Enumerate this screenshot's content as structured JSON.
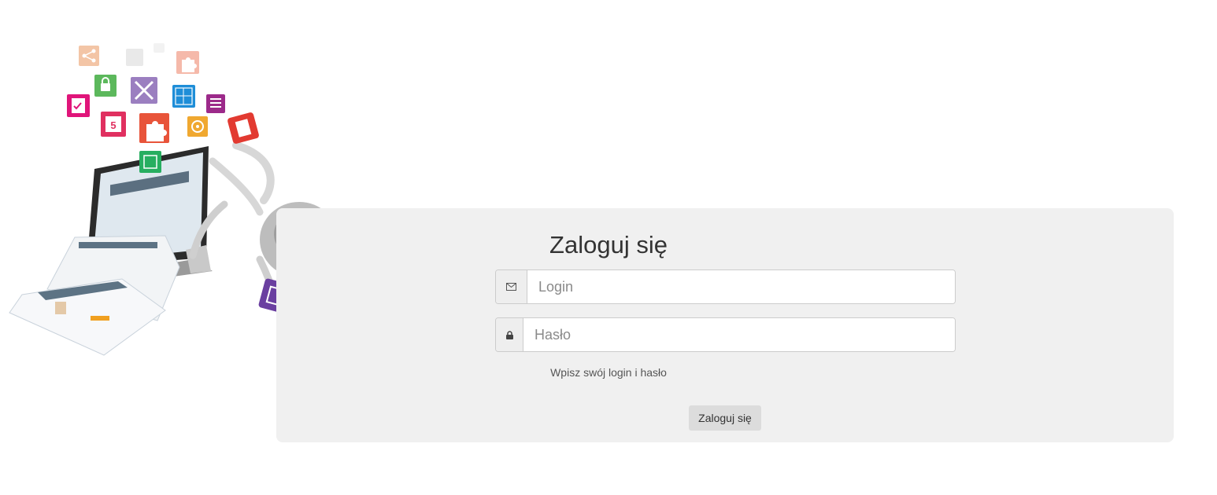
{
  "login": {
    "title": "Zaloguj się",
    "login_placeholder": "Login",
    "password_placeholder": "Hasło",
    "hint": "Wpisz swój login i hasło",
    "submit_label": "Zaloguj się"
  },
  "hero": {
    "calendar_day": "5",
    "icons": [
      "share-icon",
      "checklist-icon",
      "lock-icon",
      "expand-arrows-icon",
      "calendar-icon",
      "puzzle-icon",
      "sitemap-icon",
      "list-icon",
      "document-icon",
      "gear-icon",
      "files-icon",
      "image-icon",
      "gallery-icon"
    ]
  },
  "colors": {
    "panel_bg": "#f0f0f0",
    "button_bg": "#dcdcdc",
    "text_dark": "#333333"
  }
}
